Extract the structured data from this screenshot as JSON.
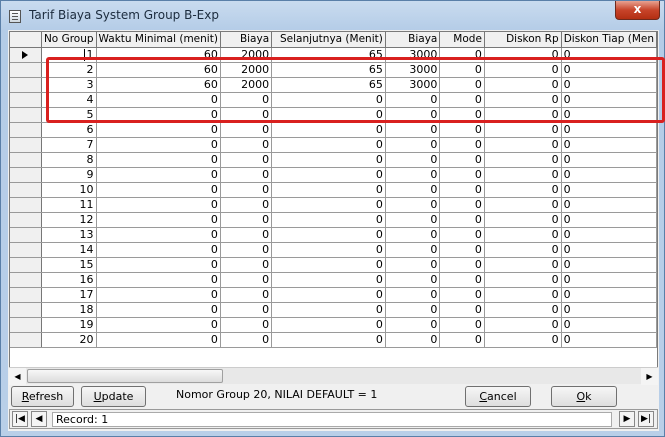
{
  "window": {
    "title": "Tarif Biaya System Group B-Exp",
    "close_glyph": "x"
  },
  "grid": {
    "columns": [
      "No Group",
      "Waktu Minimal (menit)",
      "Biaya",
      "Selanjutnya (Menit)",
      "Biaya",
      "Mode",
      "Diskon Rp",
      "Diskon Tiap (Men"
    ],
    "rows": [
      [
        "1",
        "60",
        "2000",
        "65",
        "3000",
        "0",
        "0",
        "0"
      ],
      [
        "2",
        "60",
        "2000",
        "65",
        "3000",
        "0",
        "0",
        "0"
      ],
      [
        "3",
        "60",
        "2000",
        "65",
        "3000",
        "0",
        "0",
        "0"
      ],
      [
        "4",
        "0",
        "0",
        "0",
        "0",
        "0",
        "0",
        "0"
      ],
      [
        "5",
        "0",
        "0",
        "0",
        "0",
        "0",
        "0",
        "0"
      ],
      [
        "6",
        "0",
        "0",
        "0",
        "0",
        "0",
        "0",
        "0"
      ],
      [
        "7",
        "0",
        "0",
        "0",
        "0",
        "0",
        "0",
        "0"
      ],
      [
        "8",
        "0",
        "0",
        "0",
        "0",
        "0",
        "0",
        "0"
      ],
      [
        "9",
        "0",
        "0",
        "0",
        "0",
        "0",
        "0",
        "0"
      ],
      [
        "10",
        "0",
        "0",
        "0",
        "0",
        "0",
        "0",
        "0"
      ],
      [
        "11",
        "0",
        "0",
        "0",
        "0",
        "0",
        "0",
        "0"
      ],
      [
        "12",
        "0",
        "0",
        "0",
        "0",
        "0",
        "0",
        "0"
      ],
      [
        "13",
        "0",
        "0",
        "0",
        "0",
        "0",
        "0",
        "0"
      ],
      [
        "14",
        "0",
        "0",
        "0",
        "0",
        "0",
        "0",
        "0"
      ],
      [
        "15",
        "0",
        "0",
        "0",
        "0",
        "0",
        "0",
        "0"
      ],
      [
        "16",
        "0",
        "0",
        "0",
        "0",
        "0",
        "0",
        "0"
      ],
      [
        "17",
        "0",
        "0",
        "0",
        "0",
        "0",
        "0",
        "0"
      ],
      [
        "18",
        "0",
        "0",
        "0",
        "0",
        "0",
        "0",
        "0"
      ],
      [
        "19",
        "0",
        "0",
        "0",
        "0",
        "0",
        "0",
        "0"
      ],
      [
        "20",
        "0",
        "0",
        "0",
        "0",
        "0",
        "0",
        "0"
      ]
    ],
    "current_row_index": 0,
    "highlight_color": "#d9201f"
  },
  "buttons": {
    "refresh": {
      "accel": "R",
      "rest": "efresh"
    },
    "update": {
      "accel": "U",
      "rest": "pdate"
    },
    "cancel": {
      "accel": "C",
      "rest": "ancel"
    },
    "ok": {
      "accel": "O",
      "rest": "k"
    }
  },
  "status": {
    "text": "Nomor Group 20, NILAI DEFAULT = 1"
  },
  "navigator": {
    "label": "Record: 1"
  },
  "icons": [
    "app-icon",
    "close-icon",
    "current-row-arrow-icon",
    "scroll-left-icon",
    "scroll-right-icon",
    "first-record-icon",
    "prev-record-icon",
    "next-record-icon",
    "last-record-icon"
  ]
}
